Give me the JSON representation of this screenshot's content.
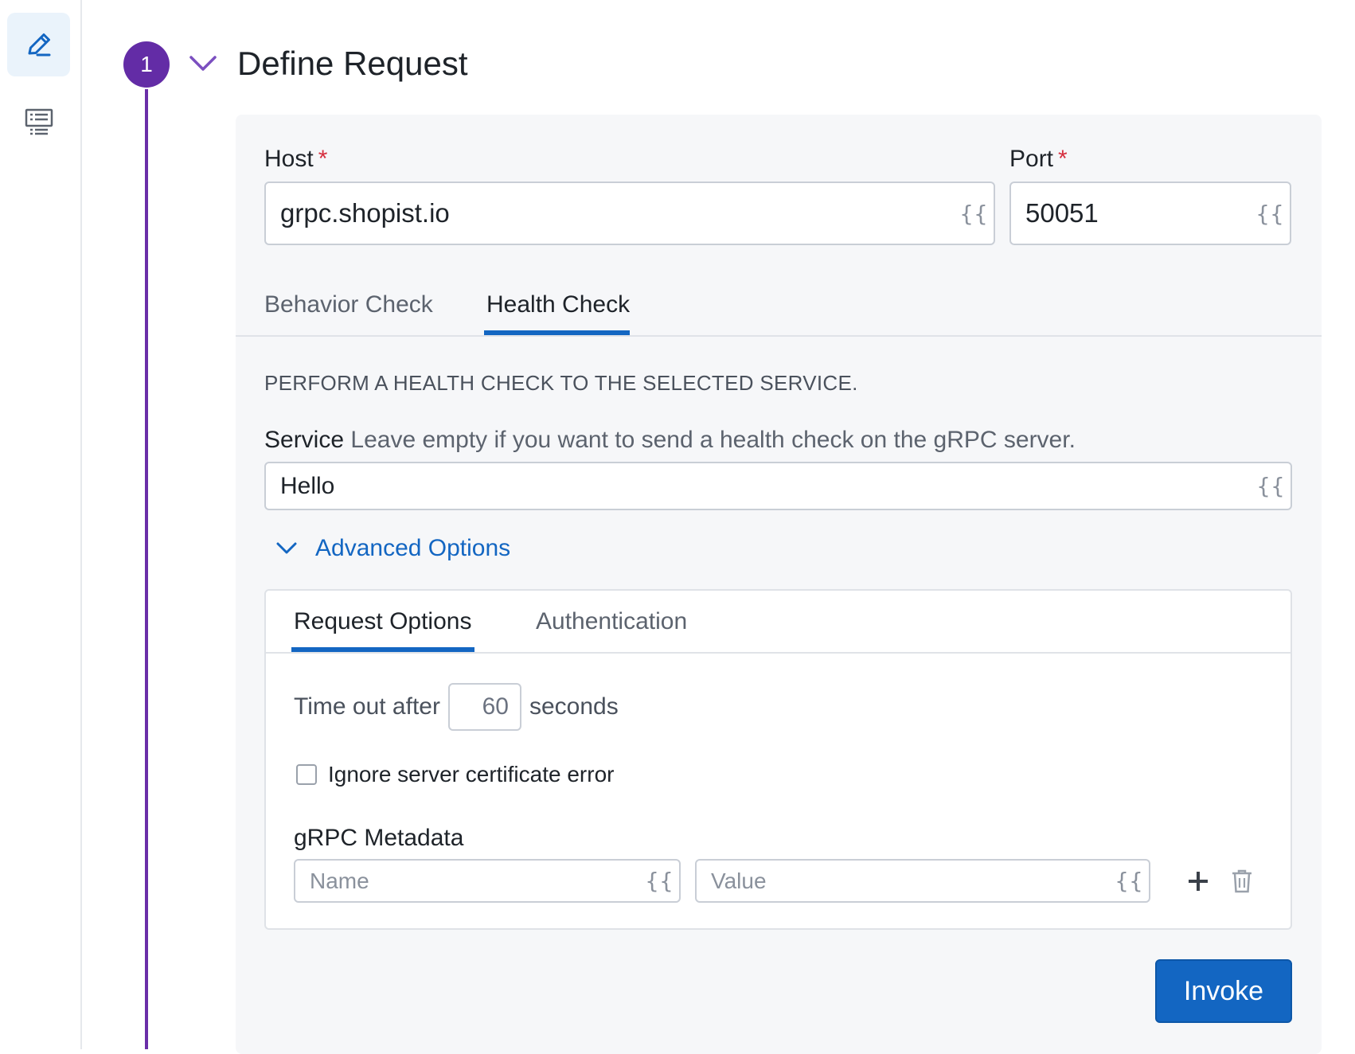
{
  "rail": {
    "items": [
      {
        "icon": "pencil-icon",
        "active": true
      },
      {
        "icon": "list-view-icon",
        "active": false
      }
    ]
  },
  "step": {
    "number": "1",
    "title": "Define Request"
  },
  "host": {
    "label": "Host",
    "required_mark": "*",
    "value": "grpc.shopist.io",
    "variable_icon": "{{"
  },
  "port": {
    "label": "Port",
    "required_mark": "*",
    "value": "50051",
    "variable_icon": "{{"
  },
  "check_tabs": [
    {
      "label": "Behavior Check",
      "active": false
    },
    {
      "label": "Health Check",
      "active": true
    }
  ],
  "health_check": {
    "description": "PERFORM A HEALTH CHECK TO THE SELECTED SERVICE.",
    "service_label": "Service",
    "service_hint": "Leave empty if you want to send a health check on the gRPC server.",
    "service_value": "Hello",
    "variable_icon": "{{"
  },
  "advanced": {
    "toggle_label": "Advanced Options",
    "tabs": [
      {
        "label": "Request Options",
        "active": true
      },
      {
        "label": "Authentication",
        "active": false
      }
    ],
    "timeout_prefix": "Time out after",
    "timeout_value": "60",
    "timeout_suffix": "seconds",
    "ignore_cert_label": "Ignore server certificate error",
    "ignore_cert_checked": false,
    "metadata_label": "gRPC Metadata",
    "metadata_name_placeholder": "Name",
    "metadata_value_placeholder": "Value",
    "variable_icon": "{{"
  },
  "actions": {
    "invoke_label": "Invoke"
  },
  "colors": {
    "accent_blue": "#1366c2",
    "step_purple": "#632ca6",
    "required_red": "#d62f3f"
  }
}
